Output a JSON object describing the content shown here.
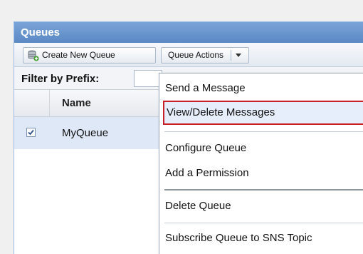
{
  "panel": {
    "title": "Queues"
  },
  "toolbar": {
    "create_label": "Create New Queue",
    "create_icon": "database-add-icon",
    "actions_label": "Queue Actions",
    "actions_icon": "dropdown-arrow-icon"
  },
  "filter": {
    "label": "Filter by Prefix:",
    "value": ""
  },
  "grid": {
    "columns": [
      "Name"
    ],
    "rows": [
      {
        "checked": true,
        "name": "MyQueue"
      }
    ]
  },
  "menu": {
    "items": [
      {
        "label": "Send a Message"
      },
      {
        "label": "View/Delete Messages",
        "highlighted": true
      },
      {
        "label": "Configure Queue"
      },
      {
        "label": "Add a Permission"
      },
      {
        "label": "Delete Queue"
      },
      {
        "label": "Subscribe Queue to SNS Topic"
      }
    ]
  },
  "colors": {
    "header": "#5b88c5",
    "highlight_border": "#c8202a",
    "row_selected": "#dfe8f6"
  }
}
